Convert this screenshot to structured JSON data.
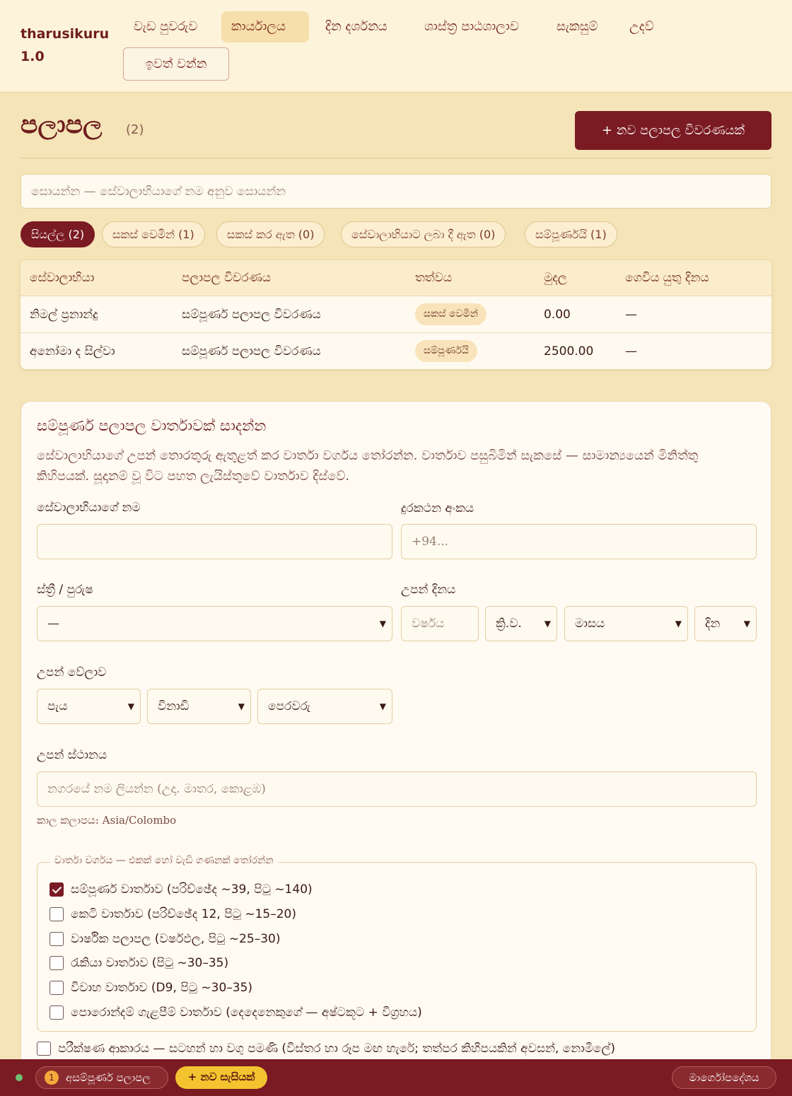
{
  "header": {
    "brand": "tharusikuru 1.0",
    "nav": [
      "වැඩ පුවරුව",
      "කාර්යාලය",
      "දින දර්ශනය",
      "ශාස්ත්‍ර පාඨශාලාව",
      "සැකසුම්",
      "උදව්"
    ],
    "active_nav": "කාර්යාලය",
    "logout": "ඉවත් වන්න"
  },
  "page": {
    "title": "පලාපල",
    "count": "(2)",
    "new_button": "+ නව පලාපල විවරණයක්",
    "search_placeholder": "සොයන්න — සේවාලාභියාගේ නම අනුව සොයන්න"
  },
  "filters": [
    {
      "label": "සියල්ල (2)",
      "active": true
    },
    {
      "label": "සකස් වෙමින් (1)",
      "active": false
    },
    {
      "label": "සකස් කර ඇත (0)",
      "active": false
    },
    {
      "label": "සේවාලාභියාට ලබා දී ඇත (0)",
      "active": false
    },
    {
      "label": "සම්පූර්ණයි (1)",
      "active": false
    }
  ],
  "table": {
    "columns": [
      "සේවාලාභියා",
      "පලාපල විවරණය",
      "තත්වය",
      "මුදල",
      "ගෙවිය යුතු දිනය"
    ],
    "rows": [
      {
        "client": "නිමල් ප්‍රනාන්දු",
        "reading": "සම්පූර්ණ පලාපල විවරණය",
        "status": "සකස් වෙමින්",
        "amount": "0.00",
        "due": "—"
      },
      {
        "client": "අනෝමා ද සිල්වා",
        "reading": "සම්පූර්ණ පලාපල විවරණය",
        "status": "සම්පූර්ණයි",
        "amount": "2500.00",
        "due": "—"
      }
    ]
  },
  "form": {
    "title": "සම්පූර්ණ පලාපල වාර්තාවක් සාදන්න",
    "description": "සේවාලාභියාගේ උපන් තොරතුරු ඇතුළත් කර වාර්තා වර්ගය තෝරන්න. වාර්තාව පසුබිමින් සැකසේ — සාමාන්‍යයෙන් මිනිත්තු කිහිපයක්. සූදානම් වූ විට පහත ලැයිස්තුවේ වාර්තාව දිස්වේ.",
    "name_label": "සේවාලාභියාගේ නම",
    "name_value": "",
    "phone_label": "දුරකථන අංකය",
    "phone_placeholder": "+94...",
    "gender_label": "ස්ත්‍රී / පුරුෂ",
    "gender_value": "—",
    "dob_label": "උපන් දිනය",
    "year_placeholder": "වර්ෂය",
    "era_value": "ක්‍රි.ව.",
    "month_value": "මාසය",
    "day_value": "දින",
    "time_label": "උපන් වේලාව",
    "hour_value": "පැය",
    "minute_value": "විනාඩි",
    "ampm_value": "පෙරවරු",
    "place_label": "උපන් ස්ථානය",
    "place_placeholder": "නගරයේ නම ලියන්න (උදා. මාතර, කොළඹ)",
    "tz_label": "කාල කලාපය:",
    "tz_value": "Asia/Colombo",
    "report_types_legend": "වාර්තා වර්ගය — එකක් හෝ වැඩි ගණනක් තෝරන්න",
    "report_types": [
      {
        "label": "සම්පූර්ණ වාර්තාව (පරිච්ඡේද ~39, පිටු ~140)",
        "checked": true
      },
      {
        "label": "කෙටි වාර්තාව (පරිච්ඡේද 12, පිටු ~15–20)",
        "checked": false
      },
      {
        "label": "වාර්ෂික පලාපල (වර්ෂඵල, පිටු ~25–30)",
        "checked": false
      },
      {
        "label": "රැකියා වාර්තාව (පිටු ~30–35)",
        "checked": false
      },
      {
        "label": "විවාහ වාර්තාව (D9, පිටු ~30–35)",
        "checked": false
      },
      {
        "label": "පොරොන්දම් ගැළපීම් වාර්තාව (දෙදෙනෙකුගේ — අෂ්ටකූට + විග්‍රහය)",
        "checked": false
      }
    ],
    "test_mode_label": "පරීක්ෂණ ආකාරය — සටහන් හා වගු පමණි (විස්තර හා රූප මඟ හැරේ; තත්පර කිහිපයකින් අවසන්, නොමිලේ)",
    "test_mode_checked": false
  },
  "bottombar": {
    "incomplete_count": "1",
    "incomplete_label": "අසම්පූර්ණ පලාපල",
    "new_session": "+ නව සැසියක්",
    "guide": "මාර්ගෝපදේශය",
    "status_color": "#6fbf73"
  },
  "colors": {
    "primary": "#7a1a22",
    "background": "#f4e4b8",
    "accent": "#f4c430"
  }
}
